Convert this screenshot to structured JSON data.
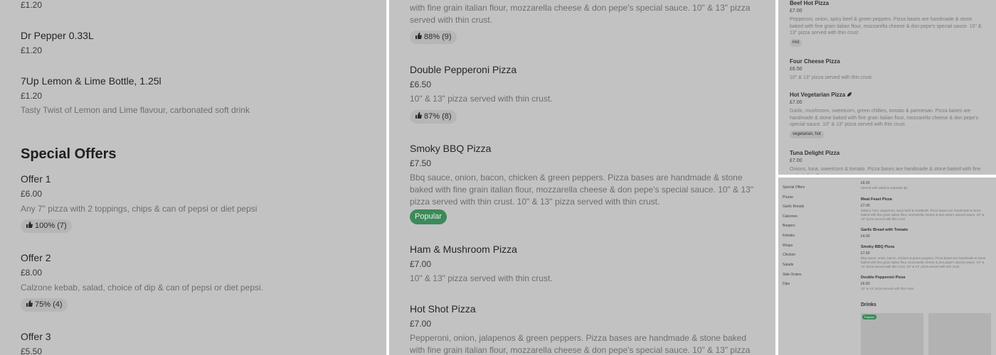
{
  "left_panel": {
    "top_price": "£1.20",
    "dr_pepper": {
      "name": "Dr Pepper 0.33L",
      "price": "£1.20"
    },
    "seven_up": {
      "name": "7Up Lemon & Lime Bottle, 1.25l",
      "price": "£1.20",
      "description": "Tasty Twist of Lemon and Lime flavour, carbonated soft drink"
    },
    "special_offers_title": "Special Offers",
    "offer1": {
      "name": "Offer 1",
      "price": "£6.00",
      "description": "Any 7\" pizza with 2 toppings, chips & can of pepsi or diet pepsi",
      "rating": "100% (7)"
    },
    "offer2": {
      "name": "Offer 2",
      "price": "£8.00",
      "description": "Calzone kebab, salad, choice of dip & can of pepsi or diet pepsi.",
      "rating": "75% (4)"
    },
    "offer3": {
      "name": "Offer 3",
      "price": "£5.50"
    }
  },
  "middle_panel": {
    "top_desc": "with fine grain italian flour, mozzarella cheese & don pepe's special sauce. 10\" & 13\" pizza served with thin crust.",
    "top_rating": "88% (9)",
    "double_pepperoni": {
      "name": "Double Pepperoni Pizza",
      "price": "£6.50",
      "description": "10\" & 13\" pizza served with thin crust.",
      "rating": "87% (8)"
    },
    "smoky_bbq": {
      "name": "Smoky BBQ Pizza",
      "price": "£7.50",
      "description": "Bbq sauce, onion, bacon, chicken & green peppers. Pizza bases are handmade & stone baked with fine grain italian flour, mozzarella cheese & don pepe's special sauce. 10\" & 13\" pizza served with thin crust. 10\" & 13\" pizza served with thin crust.",
      "badge": "Popular"
    },
    "ham_mushroom": {
      "name": "Ham & Mushroom Pizza",
      "price": "£7.00",
      "description": "10\" & 13\" pizza served with thin crust."
    },
    "hot_shot": {
      "name": "Hot Shot Pizza",
      "price": "£7.00",
      "description": "Pepperoni, onion, jalapenos & green peppers. Pizza bases are handmade & stone baked with fine grain italian flour, mozzarella cheese & don pepe's special sauce. 10\" & 13\" pizza"
    }
  },
  "right_top_panel": {
    "beef_hot": {
      "name": "Beef Hot Pizza",
      "price": "£7.00",
      "description": "Pepperoni, onion, spicy beef & green peppers. Pizza bases are handmade & stone baked with fine grain italian flour, mozzarella cheese & don pepe's special sauce. 10\" & 13\" pizza served with thin crust",
      "tag": "Hot"
    },
    "four_cheese": {
      "name": "Four Cheese Pizza",
      "price": "£6.50",
      "description": "10\" & 13\" pizza served with thin crust."
    },
    "hot_veg": {
      "name": "Hot Vegetarian Pizza",
      "price": "£7.00",
      "description": "Garlic, mushroom, sweetcorn, green chillies, tomato & parmesan. Pizza bases are handmade & stone baked with fine grain italian flour, mozzarella cheese & don pepe's special sauce. 10\" & 13\" pizza served with thin crust.",
      "tag": "vegetarian, hot"
    },
    "tuna_delight": {
      "name": "Tuna Delight Pizza",
      "price": "£7.00",
      "description": "Onions, tuna, sweetcorn & tomato. Pizza bases are handmade & stone baked with fine grain italian flour"
    }
  },
  "right_bottom_panel": {
    "categories": [
      "Special Offers",
      "Pizzas",
      "Garlic Breads",
      "Calzones",
      "Burgers",
      "Kebabs",
      "Wraps",
      "Chicken",
      "Salads",
      "Side Orders",
      "Dips"
    ],
    "top_price": "£6.50",
    "top_desc": "Served with salad & separate dip",
    "meat_feast": {
      "name": "Meat Feast Pizza",
      "price": "£7.00",
      "description": "Salami, ham, pepperoni, spicy beef & meatballs. Pizza bases are handmade & stone baked with fine grain italian flour, mozzarella cheese & don pepe's special sauce. 10\" & 13\" pizza served with thin crust"
    },
    "garlic_bread_tomato": {
      "name": "Garlic Bread with Tomato",
      "price": "£4.00"
    },
    "smoky_bbq": {
      "name": "Smoky BBQ Pizza",
      "price": "£7.50",
      "description": "Bbq sauce, onion, bacon, chicken & green peppers. Pizza bases are handmade & stone baked with fine grain italian flour, mozzarella cheese & don pepe's special sauce. 10\" & 13\" pizza served with thin crust. 10\" & 13\" pizza served with thin crust."
    },
    "double_pepperoni": {
      "name": "Double Pepperoni Pizza",
      "price": "£6.50",
      "description": "10\" & 13\" pizza served with thin crust."
    },
    "drinks_title": "Drinks",
    "popular_badge": "Popular"
  }
}
